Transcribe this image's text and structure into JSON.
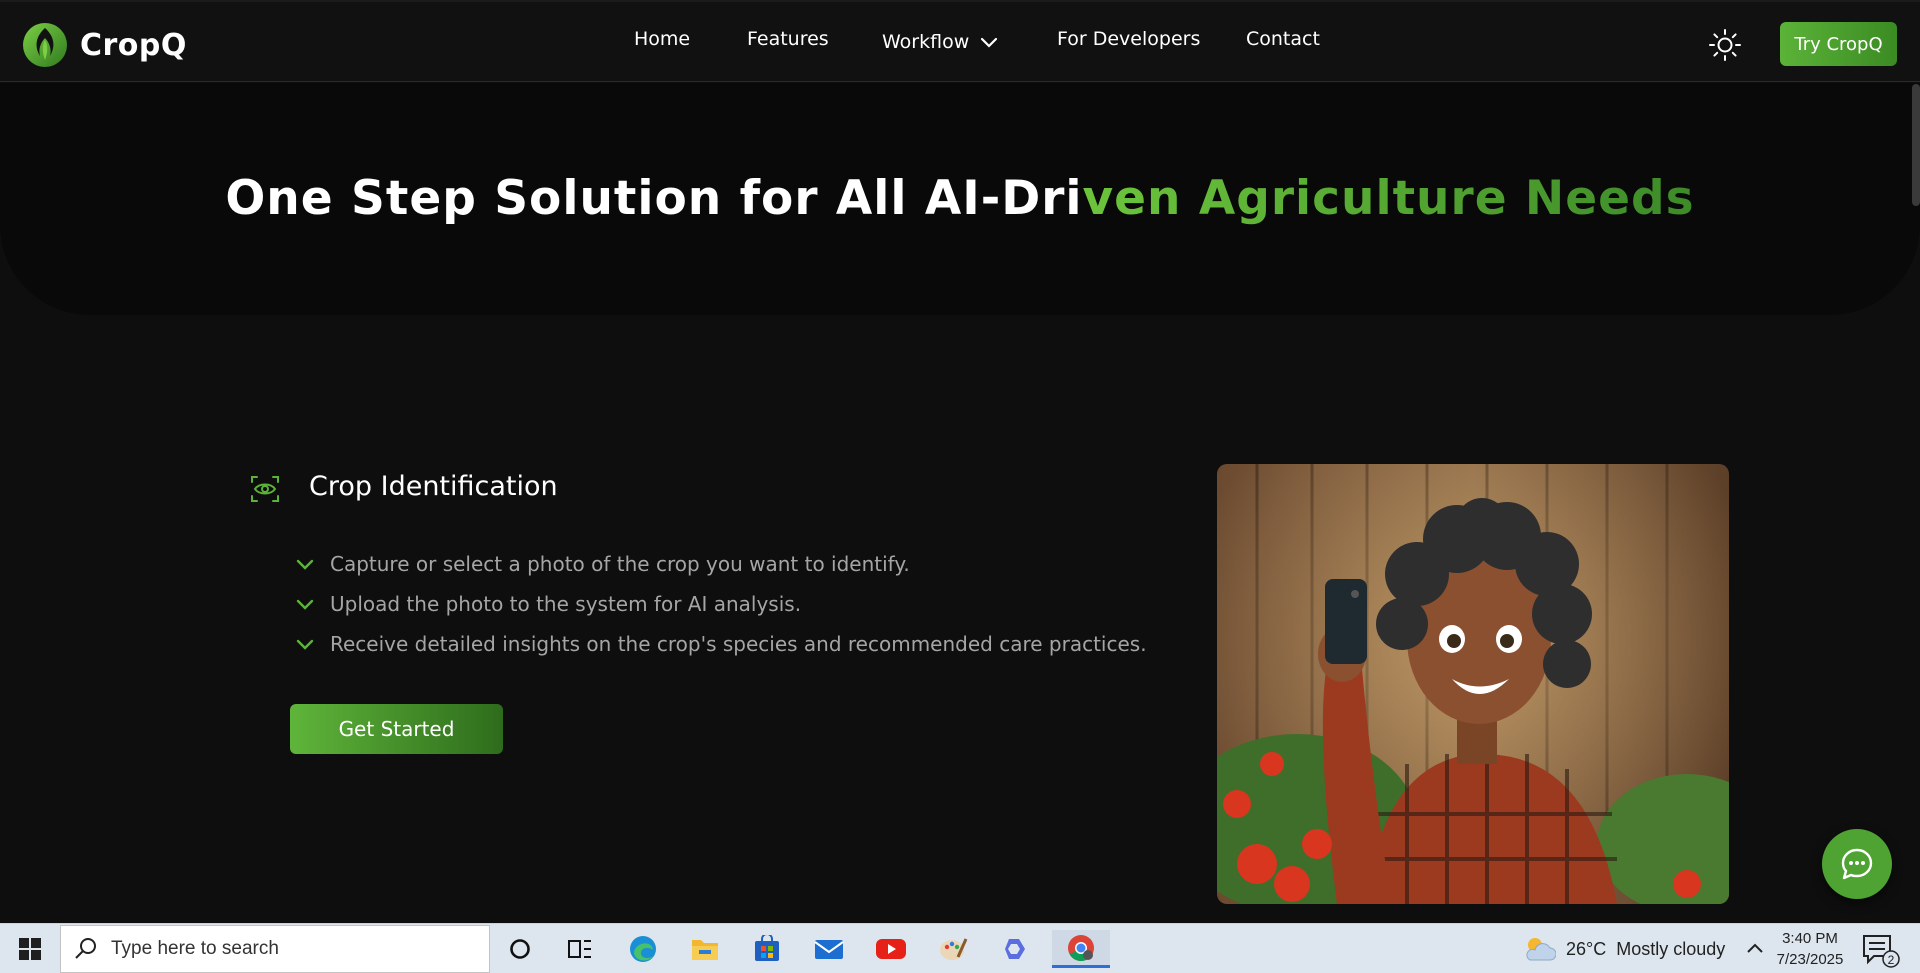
{
  "brand": {
    "name": "CropQ",
    "accent": "#5bb338"
  },
  "nav": {
    "items": [
      {
        "label": "Home"
      },
      {
        "label": "Features"
      },
      {
        "label": "Workflow"
      },
      {
        "label": "For Developers"
      },
      {
        "label": "Contact"
      }
    ],
    "theme_toggle_icon": "sun-icon",
    "try_label": "Try CropQ"
  },
  "hero": {
    "title_white": "One Step Solution for All AI-Dri",
    "title_green": "ven Agriculture Needs"
  },
  "feature": {
    "icon": "eye-scan-icon",
    "title": "Crop Identification",
    "bullets": [
      "Capture or select a photo of the crop you want to identify.",
      "Upload the photo to the system for AI analysis.",
      "Receive detailed insights on the crop's species and recommended care practices."
    ],
    "cta_label": "Get Started"
  },
  "chat_button_icon": "chat-icon",
  "taskbar": {
    "search_placeholder": "Type here to search",
    "apps": [
      "cortana-icon",
      "task-view-icon",
      "edge-icon",
      "file-explorer-icon",
      "store-icon",
      "mail-icon",
      "youtube-icon",
      "paint-icon",
      "copilot-icon",
      "chrome-icon"
    ],
    "weather": {
      "temp": "26°C",
      "condition": "Mostly cloudy"
    },
    "clock": {
      "time": "3:40 PM",
      "date": "7/23/2025"
    },
    "notifications_count": "2"
  }
}
